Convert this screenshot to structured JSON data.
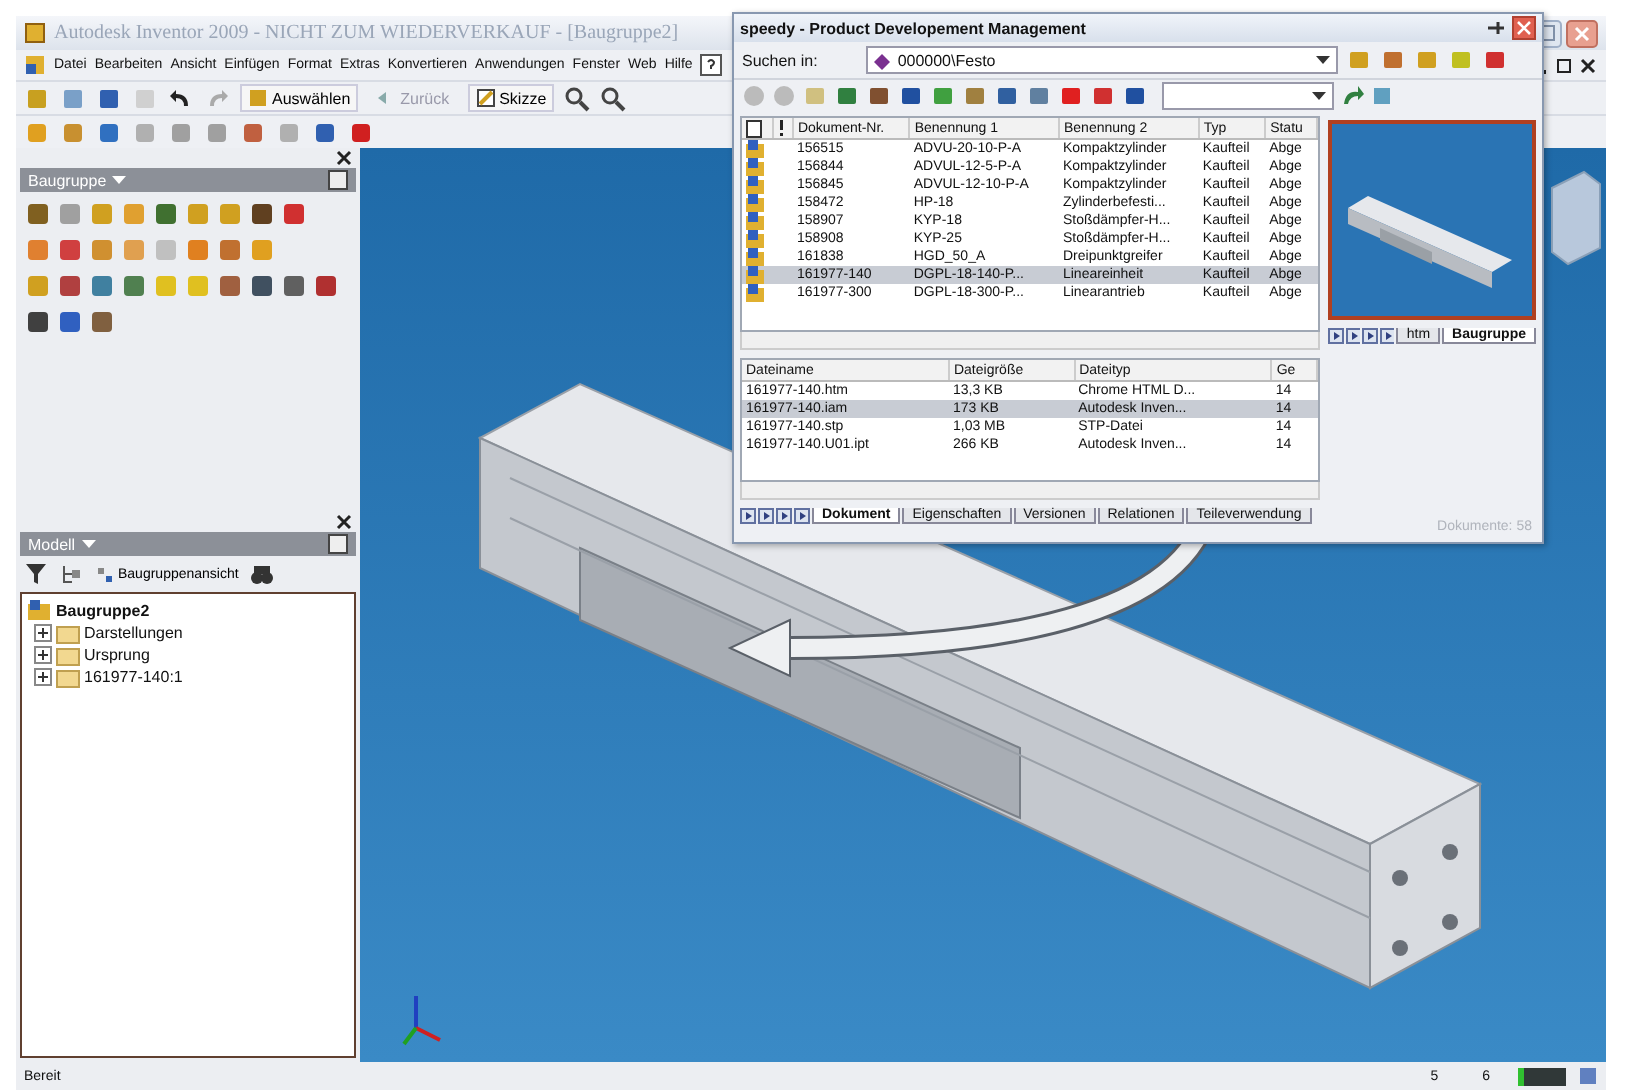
{
  "window": {
    "title": "Autodesk Inventor 2009 - NICHT ZUM WIEDERVERKAUF - [Baugruppe2]"
  },
  "menu": [
    "Datei",
    "Bearbeiten",
    "Ansicht",
    "Einfügen",
    "Format",
    "Extras",
    "Konvertieren",
    "Anwendungen",
    "Fenster",
    "Web",
    "Hilfe"
  ],
  "toolbar": {
    "select_label": "Auswählen",
    "back_label": "Zurück",
    "sketch_label": "Skizze"
  },
  "assembly_panel": {
    "title": "Baugruppe"
  },
  "model_panel": {
    "title": "Modell",
    "view_label": "Baugruppenansicht",
    "tree": {
      "label": "Baugruppe2",
      "children": [
        {
          "label": "Darstellungen",
          "expanded": false
        },
        {
          "label": "Ursprung",
          "expanded": false
        },
        {
          "label": "161977-140:1",
          "expanded": false
        }
      ]
    }
  },
  "pdm_window": {
    "title": "speedy - Product Developement Management",
    "search_label": "Suchen in:",
    "search_path": "000000\\Festo",
    "documents": {
      "columns": [
        "Dokument-Nr.",
        "Benennung 1",
        "Benennung 2",
        "Typ",
        "Statu"
      ],
      "rows": [
        {
          "cells": [
            "156515",
            "ADVU-20-10-P-A",
            "Kompaktzylinder",
            "Kaufteil",
            "Abge"
          ],
          "selected": false
        },
        {
          "cells": [
            "156844",
            "ADVUL-12-5-P-A",
            "Kompaktzylinder",
            "Kaufteil",
            "Abge"
          ],
          "selected": false
        },
        {
          "cells": [
            "156845",
            "ADVUL-12-10-P-A",
            "Kompaktzylinder",
            "Kaufteil",
            "Abge"
          ],
          "selected": false
        },
        {
          "cells": [
            "158472",
            "HP-18",
            "Zylinderbefesti...",
            "Kaufteil",
            "Abge"
          ],
          "selected": false
        },
        {
          "cells": [
            "158907",
            "KYP-18",
            "Stoßdämpfer-H...",
            "Kaufteil",
            "Abge"
          ],
          "selected": false
        },
        {
          "cells": [
            "158908",
            "KYP-25",
            "Stoßdämpfer-H...",
            "Kaufteil",
            "Abge"
          ],
          "selected": false
        },
        {
          "cells": [
            "161838",
            "HGD_50_A",
            "Dreipunktgreifer",
            "Kaufteil",
            "Abge"
          ],
          "selected": false
        },
        {
          "cells": [
            "161977-140",
            "DGPL-18-140-P...",
            "Lineareinheit",
            "Kaufteil",
            "Abge"
          ],
          "selected": true
        },
        {
          "cells": [
            "161977-300",
            "DGPL-18-300-P...",
            "Linearantrieb",
            "Kaufteil",
            "Abge"
          ],
          "selected": false
        }
      ]
    },
    "files": {
      "columns": [
        "Dateiname",
        "Dateigröße",
        "Dateityp",
        "Ge"
      ],
      "rows": [
        {
          "cells": [
            "161977-140.htm",
            "13,3 KB",
            "Chrome HTML D...",
            "14"
          ],
          "selected": false
        },
        {
          "cells": [
            "161977-140.iam",
            "173 KB",
            "Autodesk Inven...",
            "14"
          ],
          "selected": true
        },
        {
          "cells": [
            "161977-140.stp",
            "1,03 MB",
            "STP-Datei",
            "14"
          ],
          "selected": false
        },
        {
          "cells": [
            "161977-140.U01.ipt",
            "266 KB",
            "Autodesk Inven...",
            "14"
          ],
          "selected": false
        }
      ]
    },
    "preview_tabs": [
      {
        "label": "htm",
        "selected": false
      },
      {
        "label": "Baugruppe",
        "selected": true
      }
    ],
    "bottom_tabs": [
      {
        "label": "Dokument",
        "selected": true
      },
      {
        "label": "Eigenschaften",
        "selected": false
      },
      {
        "label": "Versionen",
        "selected": false
      },
      {
        "label": "Relationen",
        "selected": false
      },
      {
        "label": "Teileverwendung",
        "selected": false
      }
    ],
    "footer": "Dokumente: 58"
  },
  "status_bar": {
    "text": "Bereit",
    "fields": [
      "5",
      "6"
    ]
  }
}
